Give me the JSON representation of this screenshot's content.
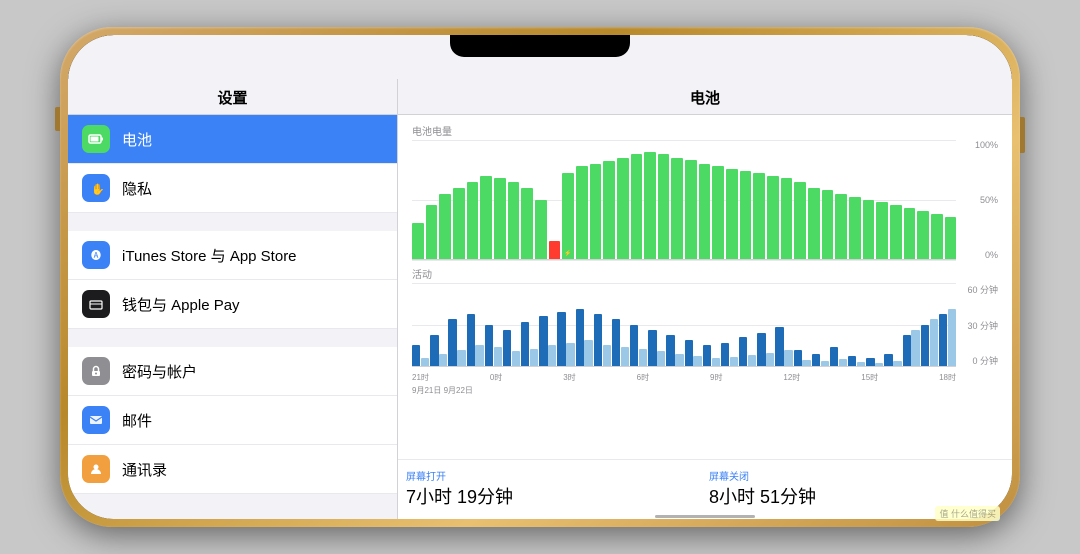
{
  "left_panel": {
    "header": "设置",
    "items": [
      {
        "id": "battery",
        "label": "电池",
        "icon_color": "battery",
        "active": true
      },
      {
        "id": "privacy",
        "label": "隐私",
        "icon_color": "privacy",
        "active": false
      },
      {
        "id": "itunes",
        "label": "iTunes Store 与 App Store",
        "icon_color": "itunes",
        "active": false
      },
      {
        "id": "wallet",
        "label": "钱包与 Apple Pay",
        "icon_color": "wallet",
        "active": false
      },
      {
        "id": "password",
        "label": "密码与帐户",
        "icon_color": "password",
        "active": false
      },
      {
        "id": "mail",
        "label": "邮件",
        "icon_color": "mail",
        "active": false
      },
      {
        "id": "contacts",
        "label": "通讯录",
        "icon_color": "contacts",
        "active": false
      }
    ]
  },
  "right_panel": {
    "header": "电池",
    "battery_chart_label": "电池电量",
    "battery_grid_labels": [
      "100%",
      "50%",
      "0%"
    ],
    "activity_chart_label": "活动",
    "activity_grid_labels": [
      "60 分钟",
      "30 分钟",
      "0 分钟"
    ],
    "x_labels": [
      "21时",
      "0时",
      "3时",
      "6时",
      "9时",
      "12时",
      "15时",
      "18时"
    ],
    "date_labels": "9月21日  9月22日",
    "summary": [
      {
        "title": "屏幕打开",
        "value": "7小时 19分钟"
      },
      {
        "title": "屏幕关闭",
        "value": "8小时 51分钟"
      }
    ]
  },
  "battery_bars": [
    30,
    45,
    55,
    60,
    65,
    70,
    68,
    65,
    60,
    50,
    15,
    72,
    78,
    80,
    82,
    85,
    88,
    90,
    88,
    85,
    83,
    80,
    78,
    76,
    74,
    72,
    70,
    68,
    65,
    60,
    58,
    55,
    52,
    50,
    48,
    45,
    43,
    40,
    38,
    35
  ],
  "activity_bars": [
    [
      20,
      8
    ],
    [
      30,
      12
    ],
    [
      45,
      15
    ],
    [
      50,
      20
    ],
    [
      40,
      18
    ],
    [
      35,
      14
    ],
    [
      42,
      16
    ],
    [
      48,
      20
    ],
    [
      52,
      22
    ],
    [
      55,
      25
    ],
    [
      50,
      20
    ],
    [
      45,
      18
    ],
    [
      40,
      16
    ],
    [
      35,
      14
    ],
    [
      30,
      12
    ],
    [
      25,
      10
    ],
    [
      20,
      8
    ],
    [
      22,
      9
    ],
    [
      28,
      11
    ],
    [
      32,
      13
    ],
    [
      38,
      15
    ],
    [
      15,
      6
    ],
    [
      12,
      5
    ],
    [
      18,
      7
    ],
    [
      10,
      4
    ],
    [
      8,
      3
    ],
    [
      12,
      5
    ],
    [
      30,
      35
    ],
    [
      40,
      45
    ],
    [
      50,
      55
    ]
  ],
  "watermark": "值 什么值得买"
}
